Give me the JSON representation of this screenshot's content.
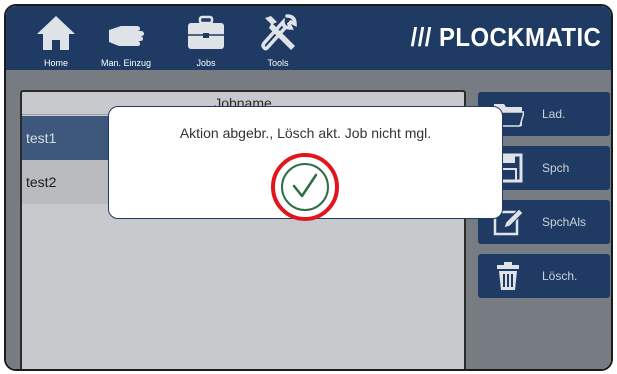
{
  "topbar": {
    "logo": "/// PLOCKMATIC",
    "nav": [
      {
        "label": "Home",
        "icon": "home-icon"
      },
      {
        "label": "Man. Einzug",
        "icon": "hand-icon"
      },
      {
        "label": "Jobs",
        "icon": "briefcase-icon"
      },
      {
        "label": "Tools",
        "icon": "tools-icon"
      }
    ],
    "color": "#1f3b63"
  },
  "job_table": {
    "header": "Jobname",
    "rows": [
      "test1",
      "test2"
    ]
  },
  "side_buttons": [
    {
      "label": "Lad.",
      "icon": "folder-icon"
    },
    {
      "label": "Spch",
      "icon": "save-icon"
    },
    {
      "label": "SpchAls",
      "icon": "edit-icon"
    },
    {
      "label": "Lösch.",
      "icon": "trash-icon"
    }
  ],
  "dialog": {
    "message": "Aktion abgebr., Lösch akt. Job nicht mgl.",
    "ok_icon": "checkmark-icon",
    "highlight_color": "#e0161c",
    "check_color": "#2f6e44"
  }
}
